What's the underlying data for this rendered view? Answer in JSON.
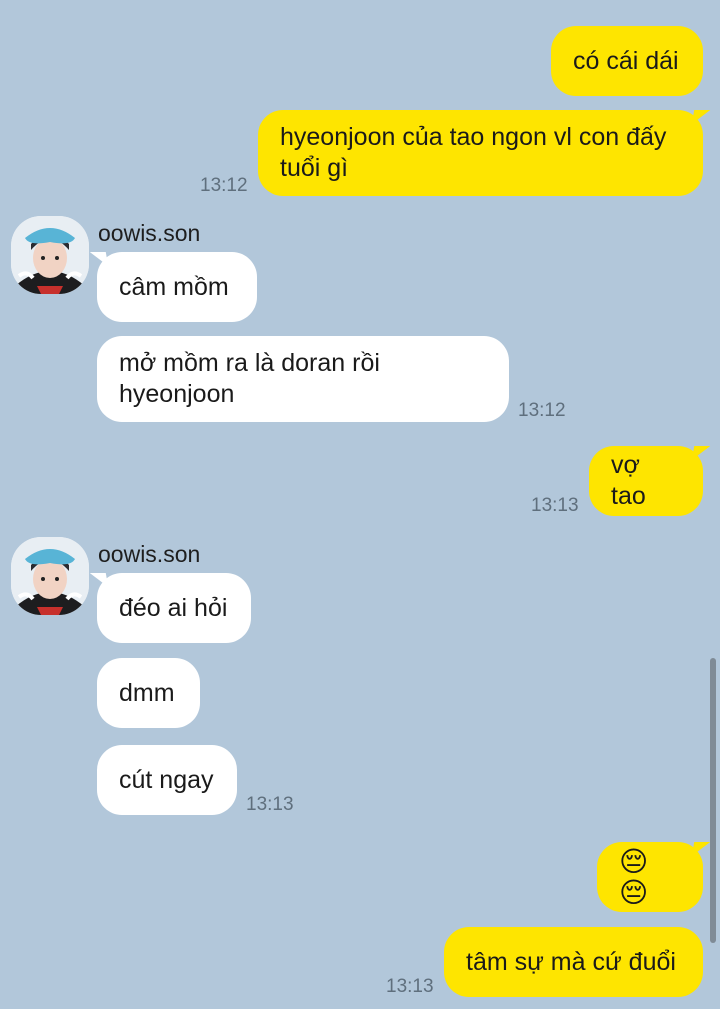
{
  "messages": [
    {
      "id": "m1",
      "dir": "out",
      "text": "có cái dái",
      "time": ""
    },
    {
      "id": "m2",
      "dir": "out",
      "text": "hyeonjoon của tao ngon vl con đấy\ntuổi gì",
      "time": "13:12"
    },
    {
      "id": "m3",
      "dir": "in",
      "sender": "oowis.son",
      "text": "câm mồm",
      "time": ""
    },
    {
      "id": "m4",
      "dir": "in",
      "text": "mở mồm ra là doran rồi\nhyeonjoon",
      "time": "13:12"
    },
    {
      "id": "m5",
      "dir": "out",
      "text": "vợ tao",
      "time": "13:13"
    },
    {
      "id": "m6",
      "dir": "in",
      "sender": "oowis.son",
      "text": "đéo ai hỏi",
      "time": ""
    },
    {
      "id": "m7",
      "dir": "in",
      "text": "dmm",
      "time": ""
    },
    {
      "id": "m8",
      "dir": "in",
      "text": "cút ngay",
      "time": "13:13"
    },
    {
      "id": "m9",
      "dir": "out",
      "text": "😔😔",
      "time": ""
    },
    {
      "id": "m10",
      "dir": "out",
      "text": "tâm sự mà cứ đuổi",
      "time": "13:13"
    }
  ],
  "contact": {
    "name": "oowis.son",
    "avatar_icon": "profile-avatar-icon"
  },
  "colors": {
    "background": "#b2c7da",
    "outgoing": "#fee500",
    "incoming": "#ffffff"
  }
}
